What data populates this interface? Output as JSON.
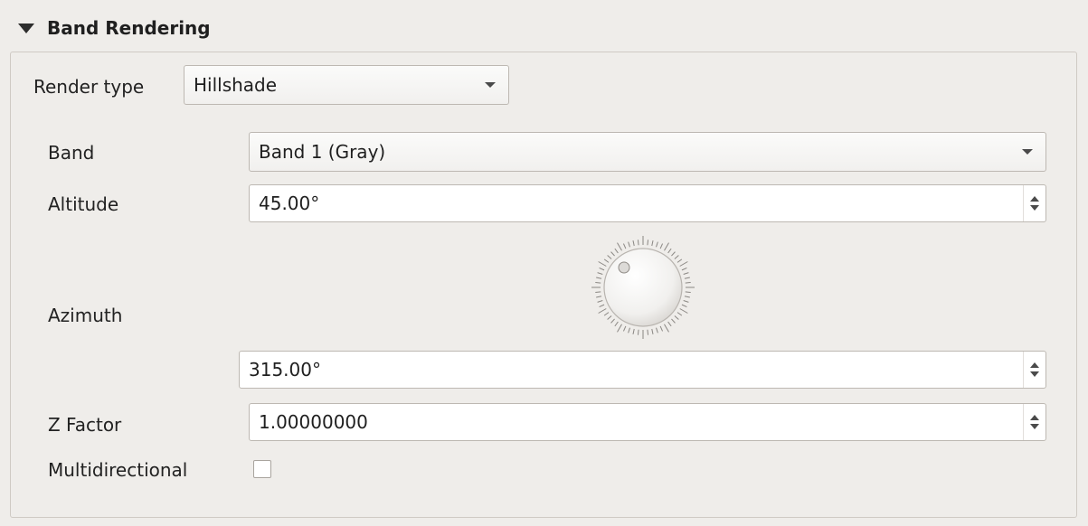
{
  "section": {
    "title": "Band Rendering",
    "expanded": true
  },
  "render_type": {
    "label": "Render type",
    "value": "Hillshade"
  },
  "band": {
    "label": "Band",
    "value": "Band 1 (Gray)"
  },
  "altitude": {
    "label": "Altitude",
    "value": "45.00°"
  },
  "azimuth": {
    "label": "Azimuth",
    "value": "315.00°",
    "dial_icon": "dial-icon"
  },
  "z_factor": {
    "label": "Z Factor",
    "value": "1.00000000"
  },
  "multidirectional": {
    "label": "Multidirectional",
    "checked": false
  },
  "icons": {
    "collapse": "triangle-down-icon",
    "dropdown": "chevron-down-icon",
    "spin": "spin-arrows-icon"
  },
  "colors": {
    "background": "#efedea",
    "field": "#ffffff",
    "border": "#bdb8b2"
  }
}
